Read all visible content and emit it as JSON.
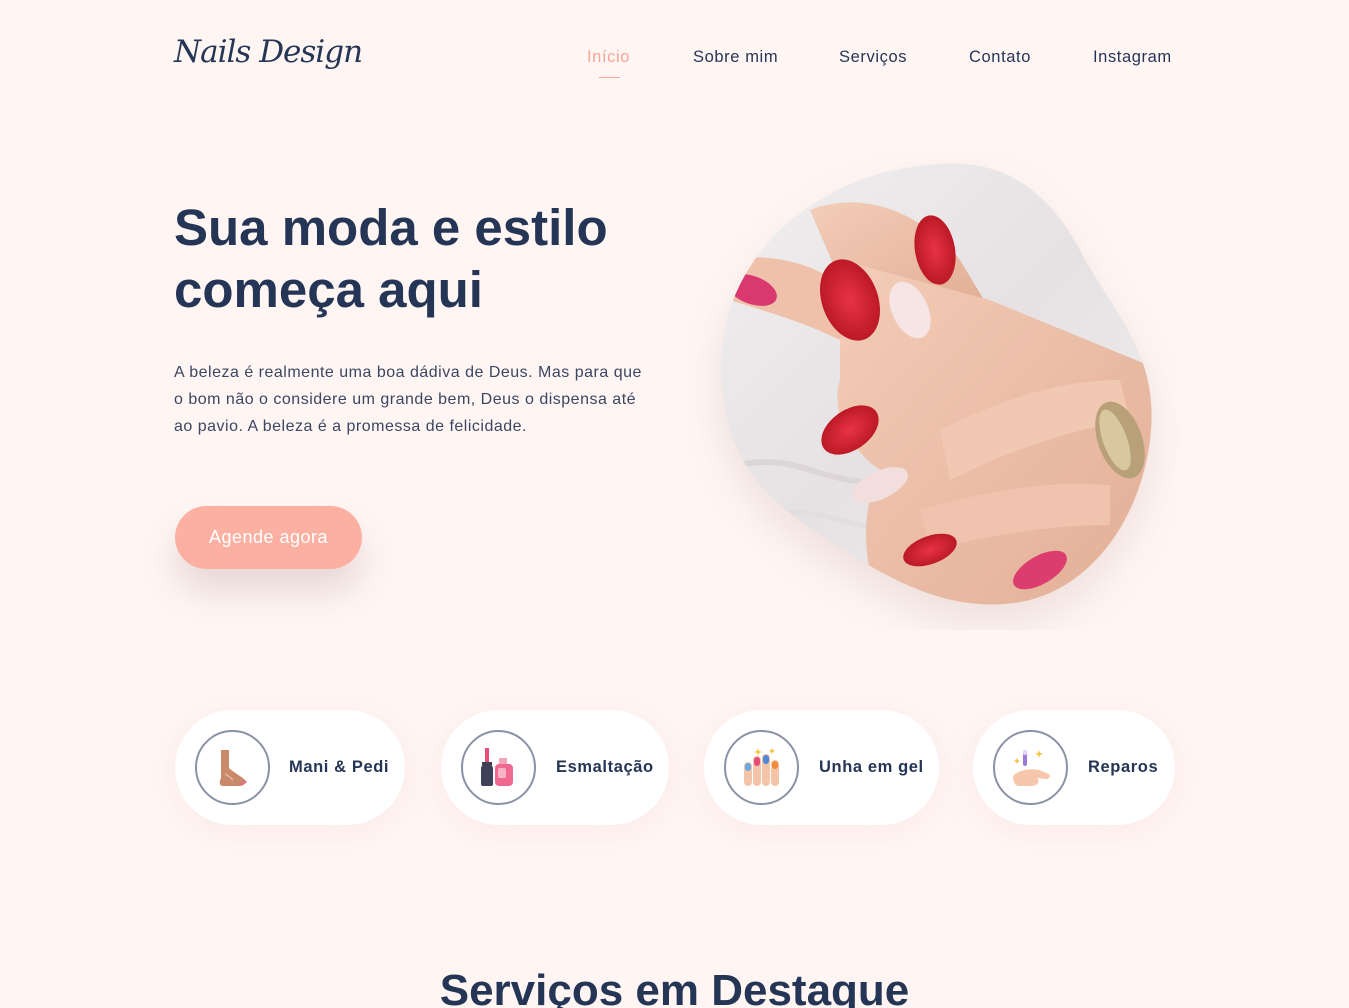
{
  "brand": {
    "logo_text": "Nails Design"
  },
  "nav": {
    "items": [
      {
        "label": "Início",
        "active": true
      },
      {
        "label": "Sobre mim",
        "active": false
      },
      {
        "label": "Serviços",
        "active": false
      },
      {
        "label": "Contato",
        "active": false
      },
      {
        "label": "Instagram",
        "active": false
      }
    ]
  },
  "hero": {
    "title_line1": "Sua moda e estilo",
    "title_line2": "começa aqui",
    "description": "A beleza é realmente uma boa dádiva de Deus. Mas para que o bom não o considere um grande bem, Deus o dispensa até ao pavio. A beleza é a promessa de felicidade.",
    "cta_label": "Agende agora",
    "image_icon": "manicured-hand-photo"
  },
  "services": [
    {
      "label": "Mani & Pedi",
      "icon": "foot-icon"
    },
    {
      "label": "Esmaltação",
      "icon": "nail-polish-icon"
    },
    {
      "label": "Unha em gel",
      "icon": "gel-nails-icon"
    },
    {
      "label": "Reparos",
      "icon": "nail-repair-icon"
    }
  ],
  "featured": {
    "title": "Serviços em Destaque"
  },
  "colors": {
    "background": "#fff6f4",
    "accent": "#f8a597",
    "text": "#253555",
    "button": "#fbb0a2"
  }
}
